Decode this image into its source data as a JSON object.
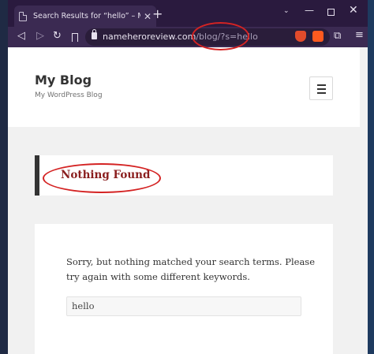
{
  "browser": {
    "tab_title": "Search Results for “hello” – My Blo",
    "tab_close": "✕",
    "new_tab": "+",
    "window": {
      "minimize": "—",
      "maximize": "",
      "close": "✕",
      "dropdown": "⌄"
    },
    "url_host": "nameheroreview.com",
    "url_path": "/blog/?s=hello",
    "icons": [
      "back-arrow-icon",
      "forward-arrow-icon",
      "reload-icon",
      "bookmark-icon",
      "lock-icon",
      "shield-icon",
      "brave-icon",
      "extensions-icon",
      "menu-icon"
    ]
  },
  "site": {
    "title": "My Blog",
    "tagline": "My WordPress Blog"
  },
  "results": {
    "heading": "Nothing Found",
    "message": "Sorry, but nothing matched your search terms. Please try again with some different keywords.",
    "search_value": "hello"
  },
  "colors": {
    "titlebar": "#2a1a3e",
    "heading": "#8a1e1e",
    "annotation": "#d42323"
  }
}
